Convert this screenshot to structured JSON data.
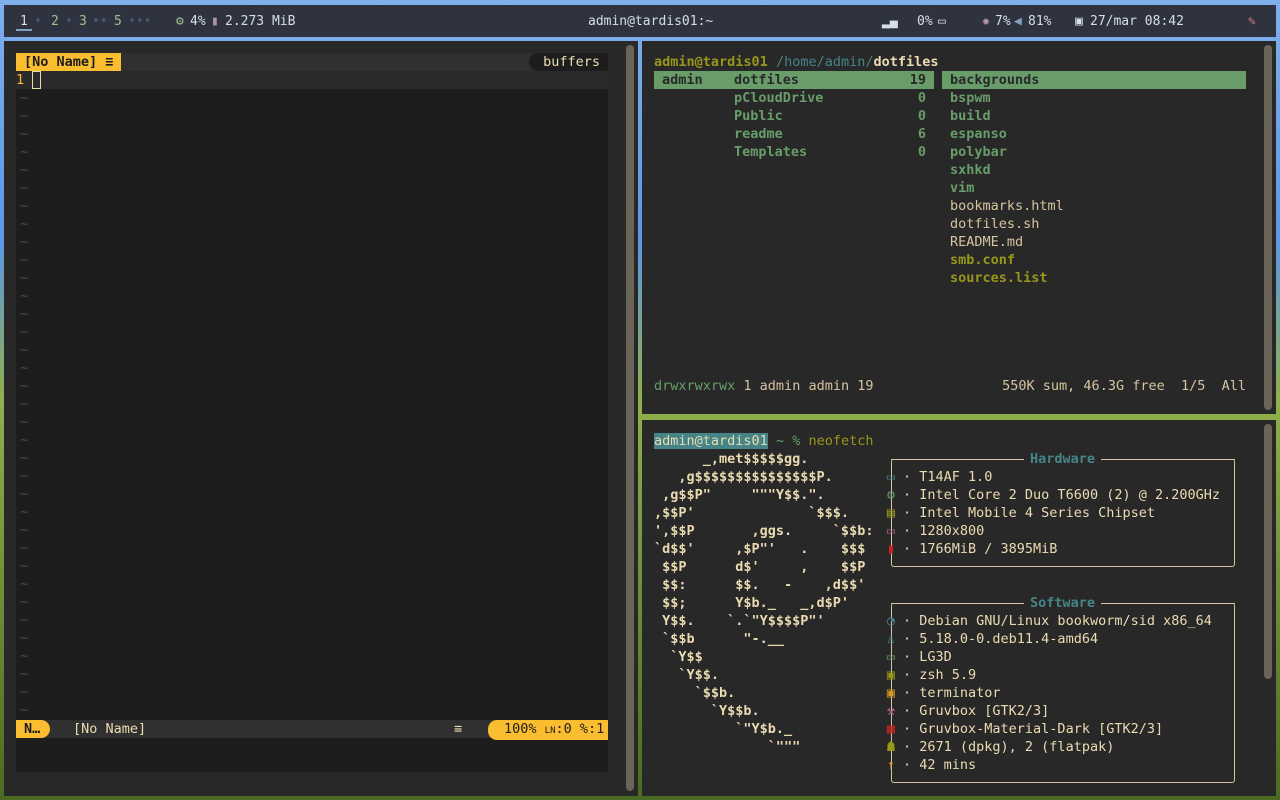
{
  "topbar": {
    "workspaces": [
      "1",
      "2",
      "3",
      "5"
    ],
    "ws_dots": [
      "•",
      "•",
      "••",
      "•••"
    ],
    "cpu": "4%",
    "mem": "2.273 MiB",
    "title": "admin@tardis01:~",
    "brightness": "0%",
    "cpu_temp": "7%",
    "volume": "81%",
    "datetime": "27/mar 08:42"
  },
  "vim": {
    "tab": "[No Name]",
    "buffers": "buffers",
    "line_number": "1",
    "mode": "N…",
    "filename": "[No Name]",
    "percent": "100%",
    "ln": ":0",
    "col": "%:1",
    "tilde": "~"
  },
  "ranger": {
    "user_host": "admin@tardis01",
    "path": "/home/admin/",
    "dir": "dotfiles",
    "col1": [
      "admin"
    ],
    "col2": [
      {
        "name": "dotfiles",
        "count": "19"
      },
      {
        "name": "pCloudDrive",
        "count": "0"
      },
      {
        "name": "Public",
        "count": "0"
      },
      {
        "name": "readme",
        "count": "6"
      },
      {
        "name": "Templates",
        "count": "0"
      }
    ],
    "col3": [
      "backgrounds",
      "bspwm",
      "build",
      "espanso",
      "polybar",
      "sxhkd",
      "vim",
      "bookmarks.html",
      "dotfiles.sh",
      "README.md",
      "smb.conf",
      "sources.list"
    ],
    "perms": "drwxrwxrwx",
    "meta": "1 admin admin 19",
    "summary": "550K sum, 46.3G free  1/5  All"
  },
  "terminal": {
    "prompt_user": "admin@tardis01",
    "prompt_rest": "~ %",
    "command": "neofetch",
    "logo": [
      "      _,met$$$$$gg.",
      "   ,g$$$$$$$$$$$$$$$P.",
      " ,g$$P\"     \"\"\"Y$$.\".",
      ",$$P'              `$$$.",
      "',$$P       ,ggs.     `$$b:",
      "`d$$'     ,$P\"'   .    $$$",
      " $$P      d$'     ,    $$P",
      " $$:      $$.   -    ,d$$'",
      " $$;      Y$b._   _,d$P'",
      " Y$$.    `.`\"Y$$$$P\"'",
      " `$$b      \"-.__",
      "  `Y$$",
      "   `Y$$.",
      "     `$$b.",
      "       `Y$$b.",
      "          `\"Y$b._",
      "              `\"\"\""
    ],
    "hardware_title": "Hardware",
    "software_title": "Software",
    "hardware": [
      "T14AF 1.0",
      "Intel Core 2 Duo T6600 (2) @ 2.200GHz",
      "Intel Mobile 4 Series Chipset",
      "1280x800",
      "1766MiB / 3895MiB"
    ],
    "software": [
      "Debian GNU/Linux bookworm/sid x86_64",
      "5.18.0-0.deb11.4-amd64",
      "LG3D",
      "zsh 5.9",
      "terminator",
      "Gruvbox [GTK2/3]",
      "Gruvbox-Material-Dark [GTK2/3]",
      "2671 (dpkg), 2 (flatpak)",
      "42 mins"
    ]
  },
  "colors": {
    "yellow": "#fabd2f",
    "aqua": "#458588",
    "sel": "#689d6a"
  }
}
